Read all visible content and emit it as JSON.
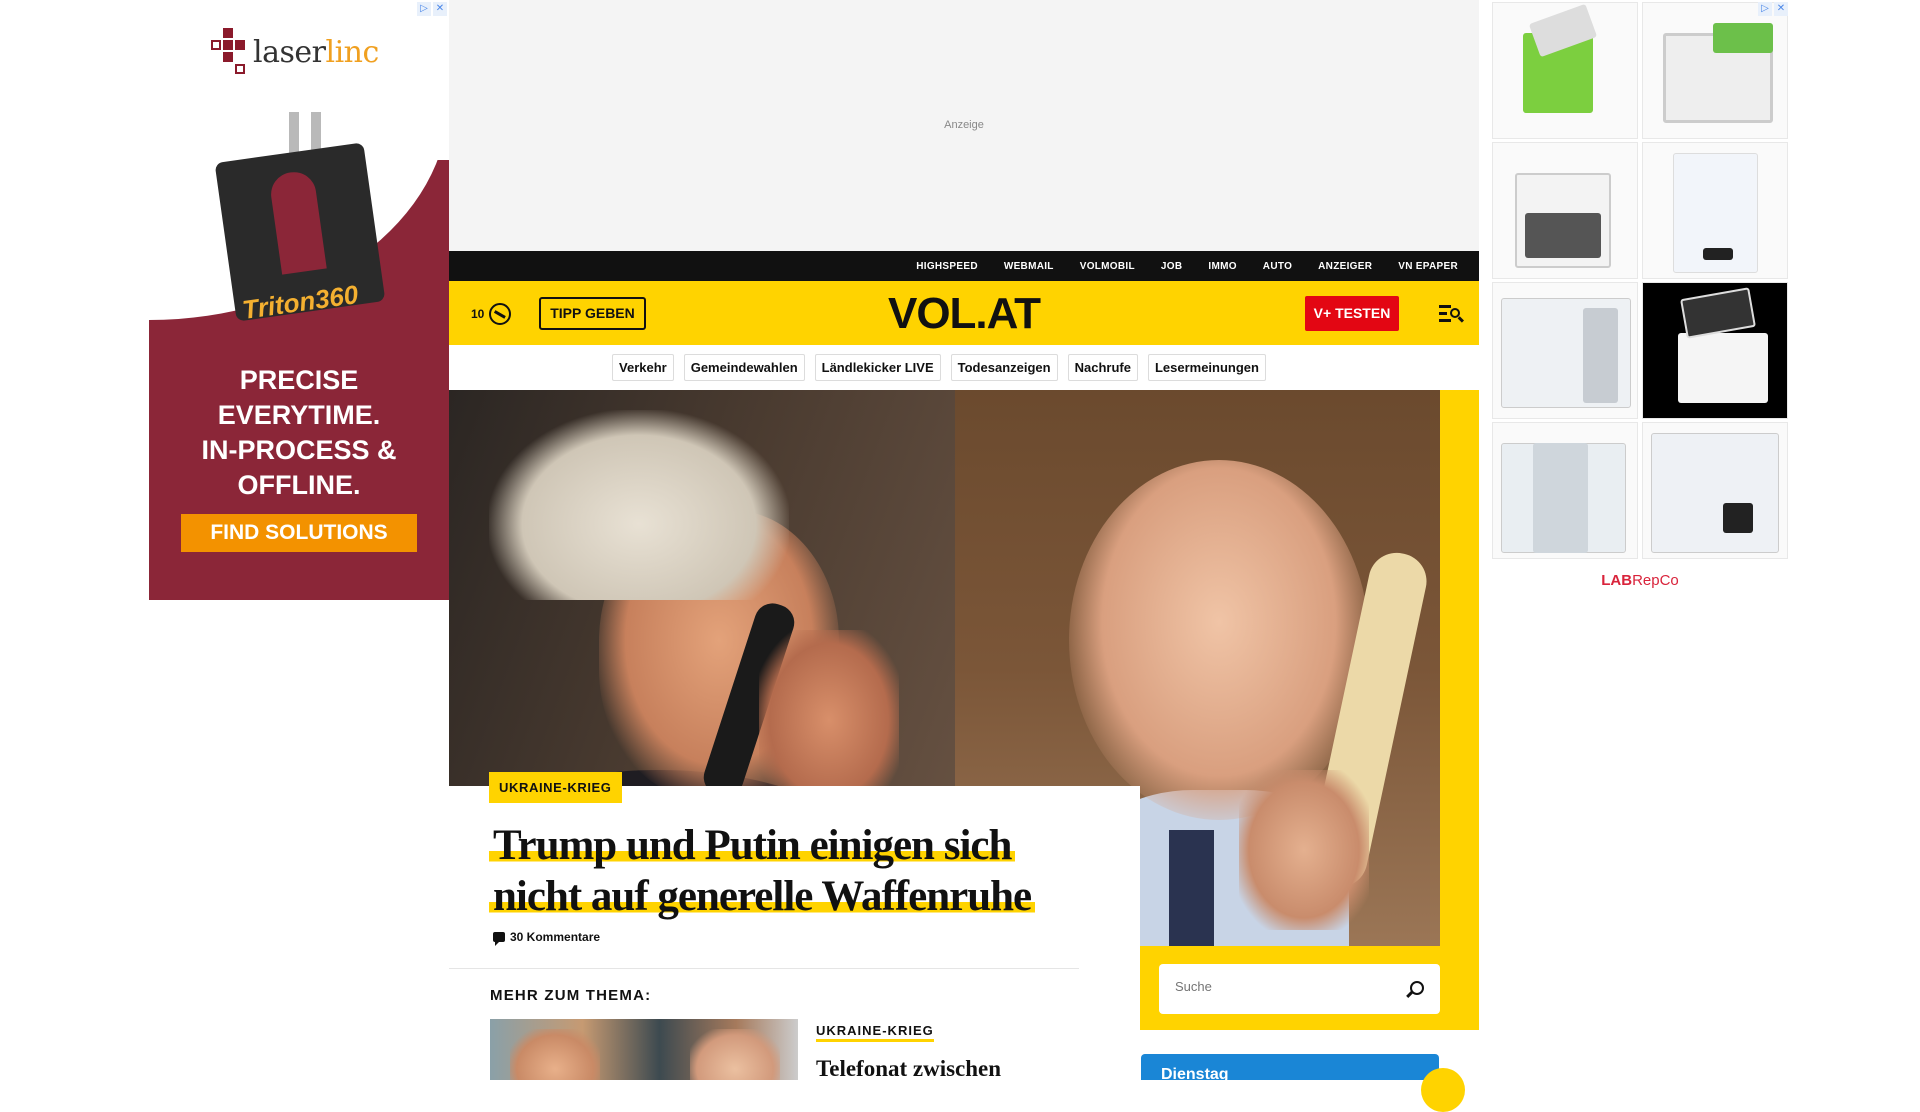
{
  "left_ad": {
    "ad_choices": [
      "▷",
      "✕"
    ],
    "brand_prefix": "laser",
    "brand_suffix": "linc",
    "product_label": "Triton360",
    "headline_lines": [
      "PRECISE",
      "EVERYTIME.",
      "IN-PROCESS &",
      "OFFLINE."
    ],
    "cta": "FIND SOLUTIONS",
    "colors": {
      "background": "#8b2638",
      "cta": "#f39200",
      "accent": "#f0a020"
    }
  },
  "top_ad": {
    "label": "Anzeige"
  },
  "top_nav": {
    "items": [
      "HIGHSPEED",
      "WEBMAIL",
      "VOLMOBIL",
      "JOB",
      "IMMO",
      "AUTO",
      "ANZEIGER",
      "VN EPAPER"
    ]
  },
  "header": {
    "count": "10",
    "count_icon": "gauge-icon",
    "tipp_label": "TIPP GEBEN",
    "logo": "VOL.AT",
    "vplus_label": "V+ TESTEN",
    "menu_icon": "menu-search-icon",
    "colors": {
      "brand_yellow": "#ffd300",
      "vplus_red": "#e30613"
    }
  },
  "categories": [
    "Verkehr",
    "Gemeindewahlen",
    "Ländlekicker LIVE",
    "Todesanzeigen",
    "Nachrufe",
    "Lesermeinungen"
  ],
  "hero": {
    "tag": "UKRAINE-KRIEG",
    "headline_line1": "Trump und Putin einigen sich",
    "headline_line2": "nicht auf generelle Waffenruhe",
    "comments": "30 Kommentare"
  },
  "search": {
    "placeholder": "Suche"
  },
  "related": {
    "heading": "MEHR ZUM THEMA:",
    "tag": "UKRAINE-KRIEG",
    "title": "Telefonat zwischen"
  },
  "weather": {
    "day": "Dienstag"
  },
  "right_ad": {
    "ad_choices": [
      "▷",
      "✕"
    ],
    "brand_lab": "LAB",
    "brand_rest": "RepCo",
    "product_count": 8
  }
}
